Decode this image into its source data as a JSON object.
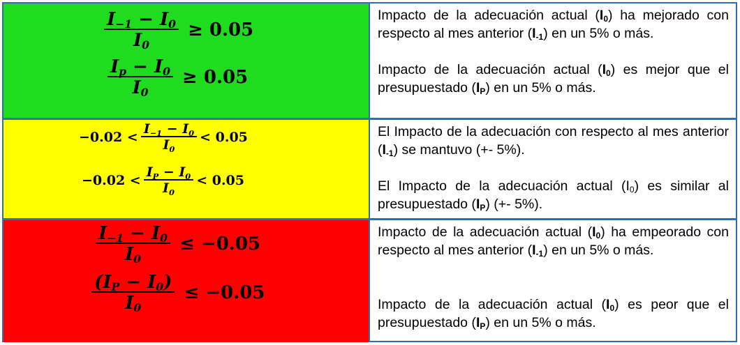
{
  "rows": [
    {
      "status": "green",
      "color": "#1fdc1f",
      "formulas": [
        {
          "num_a": "I",
          "num_a_sub": "−1",
          "minus": " − ",
          "num_b": "I",
          "num_b_sub": "0",
          "den": "I",
          "den_sub": "0",
          "rel": " ≥ 0.05",
          "left": ""
        },
        {
          "num_a": "I",
          "num_a_sub": "p",
          "minus": " − ",
          "num_b": "I",
          "num_b_sub": "0",
          "den": "I",
          "den_sub": "0",
          "rel": " ≥ 0.05",
          "left": ""
        }
      ],
      "desc1": {
        "t1": "Impacto de la adecuación actual (",
        "b1": "I",
        "b1sub": "0",
        "t2": ") ha mejorado con respecto al mes anterior (",
        "b2": "I",
        "b2sub": "-1",
        "t3": ") en un 5% o más."
      },
      "desc2": {
        "t1": "Impacto de la adecuación actual (",
        "b1": "I",
        "b1sub": "0",
        "t2": ") es mejor que el presupuestado (",
        "b2": "I",
        "b2sub": "P",
        "t3": ") en un 5% o más."
      }
    },
    {
      "status": "yellow",
      "color": "#ffff00",
      "formulas": [
        {
          "left": "−0.02 <",
          "num_a": "I",
          "num_a_sub": "−1",
          "minus": " − ",
          "num_b": "I",
          "num_b_sub": "0",
          "den": "I",
          "den_sub": "0",
          "rel": "< 0.05"
        },
        {
          "left": "−0.02 <",
          "num_a": "I",
          "num_a_sub": "P",
          "minus": " − ",
          "num_b": "I",
          "num_b_sub": "0",
          "den": "I",
          "den_sub": "0",
          "rel": "< 0.05"
        }
      ],
      "desc1": {
        "t1": "El Impacto de la adecuación con respecto al mes anterior (",
        "b1": "I",
        "b1sub": "-1",
        "t2": ") se mantuvo (+- 5%)."
      },
      "desc2": {
        "t1": "El Impacto de la adecuación actual (I",
        "t1sub": "0",
        "t2": ") es similar al presupuestado (",
        "b2": "I",
        "b2sub": "P",
        "t3": ") (+- 5%)."
      }
    },
    {
      "status": "red",
      "color": "#ff0000",
      "formulas": [
        {
          "num_a": "I",
          "num_a_sub": "−1",
          "minus": " − ",
          "num_b": "I",
          "num_b_sub": "0",
          "den": "I",
          "den_sub": "0",
          "rel": " ≤ −0.05",
          "left": ""
        },
        {
          "num_open": "(",
          "num_a": "I",
          "num_a_sub": "P",
          "minus": " − ",
          "num_b": "I",
          "num_b_sub": "0",
          "num_close": ")",
          "den": "I",
          "den_sub": "0",
          "rel": " ≤ −0.05",
          "left": ""
        }
      ],
      "desc1": {
        "t1": "Impacto de la adecuación actual (",
        "b1": "I",
        "b1sub": "0",
        "t2": ") ha empeorado con respecto al mes anterior (",
        "b2": "I",
        "b2sub": "-1",
        "t3": ") en un 5% o más."
      },
      "desc2": {
        "t1": "Impacto de la adecuación actual (",
        "b1": "I",
        "b1sub": "0",
        "t2": ") es peor que el presupuestado (",
        "b2": "I",
        "b2sub": "P",
        "t3": ") en un 5% o más."
      }
    }
  ]
}
